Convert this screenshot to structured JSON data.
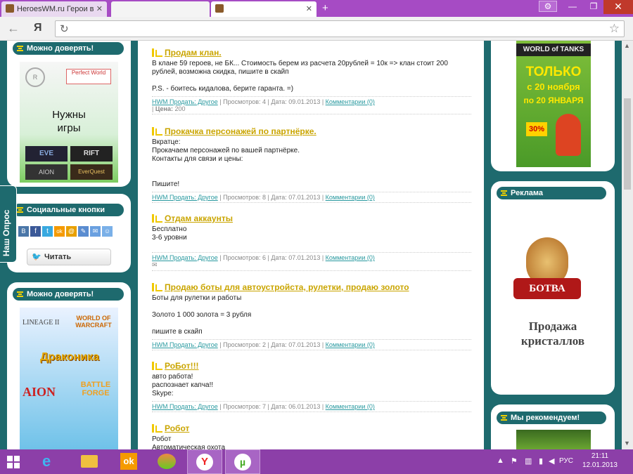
{
  "browser": {
    "tabs": [
      {
        "label": "HeroesWM.ru Герои в"
      },
      {
        "label": ""
      },
      {
        "label": ""
      }
    ],
    "new_tab": "+",
    "url": "",
    "address_logo": "Я"
  },
  "sidebar_left": {
    "trust_title": "Можно доверять!",
    "banner_text": "Нужны\nигры",
    "banner_logos": [
      "Perfect World",
      "EVE",
      "RIFT",
      "AION",
      "EverQuest"
    ],
    "social_title": "Социальные кнопки",
    "social_icons": [
      "В",
      "f",
      "t",
      "ok",
      "@",
      "✎",
      "✉",
      "☺"
    ],
    "twitter_button": "Читать",
    "trust_title_2": "Можно доверять!",
    "game_logos": [
      "LINEAGE II",
      "WORLD OF WARCRAFT",
      "Драконика",
      "AION",
      "BATTLE FORGE"
    ],
    "poll_tab": "Наш Опрос"
  },
  "posts": [
    {
      "title": "Продам клан.",
      "body": "В клане 59 героев, не БК... Стоимость берем из расчета 20рублей = 10к => клан стоит 200 рублей, возможна скидка, пишите в скайп\n\nP.S. - боитесь кидалова, берите гаранта. =)",
      "category": "HWM Продать: Другое",
      "views": "Просмотров: 4",
      "date": "Дата: 09.01.2013",
      "comments": "Комментарии (0)",
      "price_label": "Цена:",
      "price": "200"
    },
    {
      "title": "Прокачка персонажей по партнёрке.",
      "body": "Вкратце:\nПрокачаем персонажей по вашей партнёрке.\nКонтакты для связи и цены:\n\n\nПишите!",
      "category": "HWM Продать: Другое",
      "views": "Просмотров: 8",
      "date": "Дата: 07.01.2013",
      "comments": "Комментарии (0)"
    },
    {
      "title": "Отдам аккаунты",
      "body": "Бесплатно\n3-6 уровни",
      "category": "HWM Продать: Другое",
      "views": "Просмотров: 6",
      "date": "Дата: 07.01.2013",
      "comments": "Комментарии (0)"
    },
    {
      "title": "Продаю боты для автоустройста, рулетки, продаю золото",
      "body": "Боты для рулетки и работы\n\nЗолото 1 000 золота = 3 рубля\n\nпишите в скайп",
      "category": "HWM Продать: Другое",
      "views": "Просмотров: 2",
      "date": "Дата: 07.01.2013",
      "comments": "Комментарии (0)"
    },
    {
      "title": "РоБот!!!",
      "body": "авто работа!\nраспознает капча!!\nSkype:",
      "category": "HWM Продать: Другое",
      "views": "Просмотров: 7",
      "date": "Дата: 06.01.2013",
      "comments": "Комментарии (0)"
    },
    {
      "title": "Робот",
      "body": "Робот\nАвтоматическая охота",
      "category": "",
      "views": "",
      "date": "",
      "comments": ""
    }
  ],
  "sidebar_right": {
    "wot_banner": {
      "logo": "WORLD of TANKS",
      "line1": "ТОЛЬКО",
      "line2": "с 20 ноября",
      "line3": "по 20 ЯНВАРЯ",
      "discount": "30%"
    },
    "ads_title": "Реклама",
    "ad_logo": "БОТВА",
    "ad_caption": "Продажа\nкристаллов",
    "recommend_title": "Мы рекомендуем!"
  },
  "taskbar": {
    "lang": "РУС",
    "time": "21:11",
    "date": "12.01.2013"
  },
  "colors": {
    "page_bg": "#1e6a6e",
    "title_link": "#caa500",
    "meta_link": "#2a9aa0",
    "taskbar": "#8c3fa8"
  }
}
